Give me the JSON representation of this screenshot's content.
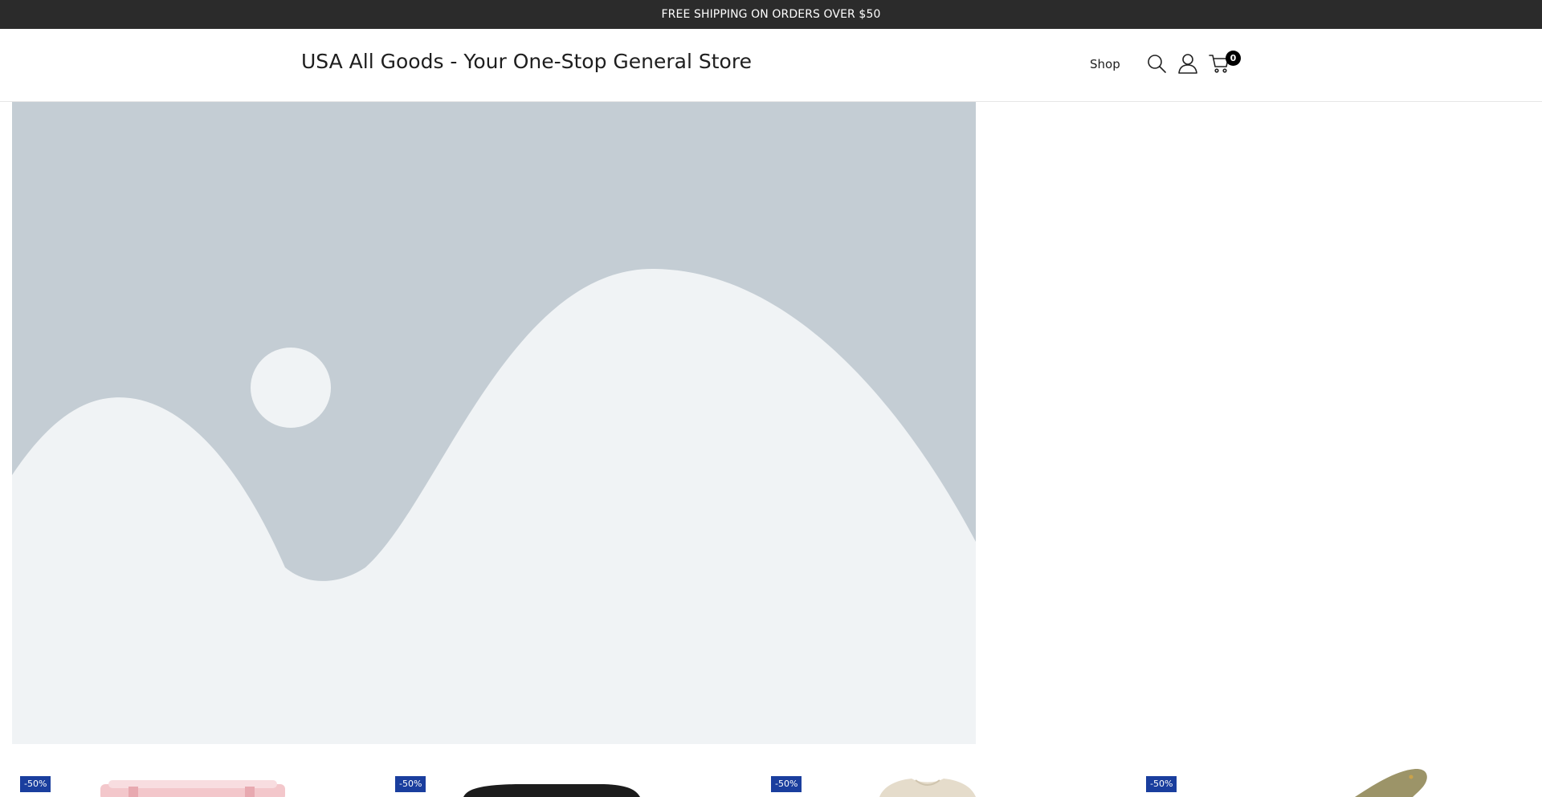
{
  "announcement": {
    "text": "FREE SHIPPING ON ORDERS OVER $50"
  },
  "header": {
    "store_title": "USA All Goods - Your One-Stop General Store",
    "nav": [
      {
        "label": "Shop"
      }
    ],
    "icons": [
      "search-icon",
      "account-icon",
      "cart-icon"
    ],
    "cart_count": "0"
  },
  "hero": {
    "image": "placeholder-landscape-image"
  },
  "products": [
    {
      "badge": "-50%",
      "image": "pink-container-image"
    },
    {
      "badge": "-50%",
      "image": "black-case-image"
    },
    {
      "badge": "-50%",
      "image": "beige-shirt-image"
    },
    {
      "badge": "-50%",
      "image": "olive-knife-image"
    }
  ],
  "colors": {
    "announcement_bg": "#2b2b2b",
    "badge_bg": "#1a3e9e",
    "placeholder_bg": "#c4cdd4",
    "placeholder_fg": "#f0f3f5"
  }
}
